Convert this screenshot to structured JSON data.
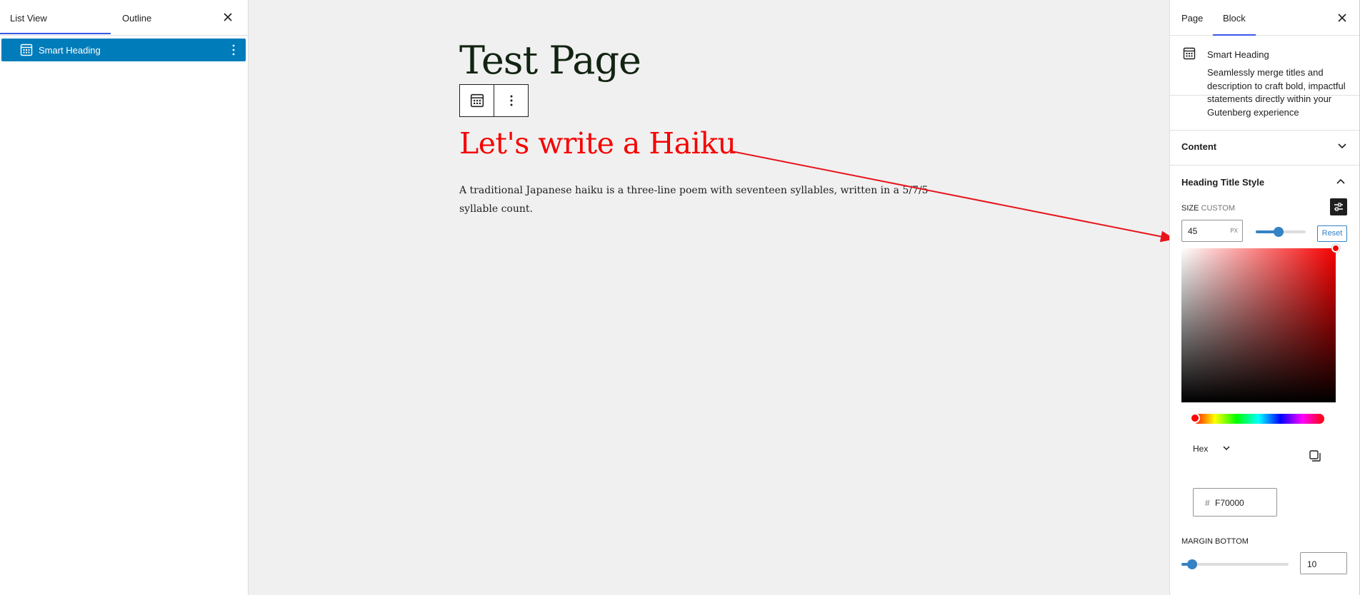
{
  "list_panel": {
    "tabs": [
      "List View",
      "Outline"
    ],
    "items": [
      {
        "label": "Smart Heading"
      }
    ]
  },
  "editor": {
    "page_title": "Test Page",
    "heading": "Let's write a Haiku",
    "description": "A traditional Japanese haiku is a three-line poem with seventeen syllables, written in a 5/7/5 syllable count.",
    "heading_color": "#f70000"
  },
  "sidebar": {
    "tabs": [
      "Page",
      "Block"
    ],
    "active_tab": "Block",
    "block": {
      "name": "Smart Heading",
      "description": "Seamlessly merge titles and description to craft bold, impactful statements directly within your Gutenberg experience"
    },
    "sections": {
      "content": "Content",
      "heading_title_style": "Heading Title Style"
    },
    "size": {
      "label": "SIZE",
      "sub_label": "CUSTOM",
      "value": "45",
      "unit": "PX",
      "reset": "Reset",
      "slider_fraction": 0.45
    },
    "color": {
      "format": "Hex",
      "hash": "#",
      "value": "F70000"
    },
    "margin_bottom": {
      "label": "MARGIN BOTTOM",
      "value": "10",
      "slider_fraction": 0.1
    }
  },
  "icons": [
    "grid-block-icon",
    "kebab-menu-icon",
    "close-icon",
    "chevron-down-icon",
    "chevron-up-icon",
    "sliders-icon",
    "copy-icon"
  ]
}
